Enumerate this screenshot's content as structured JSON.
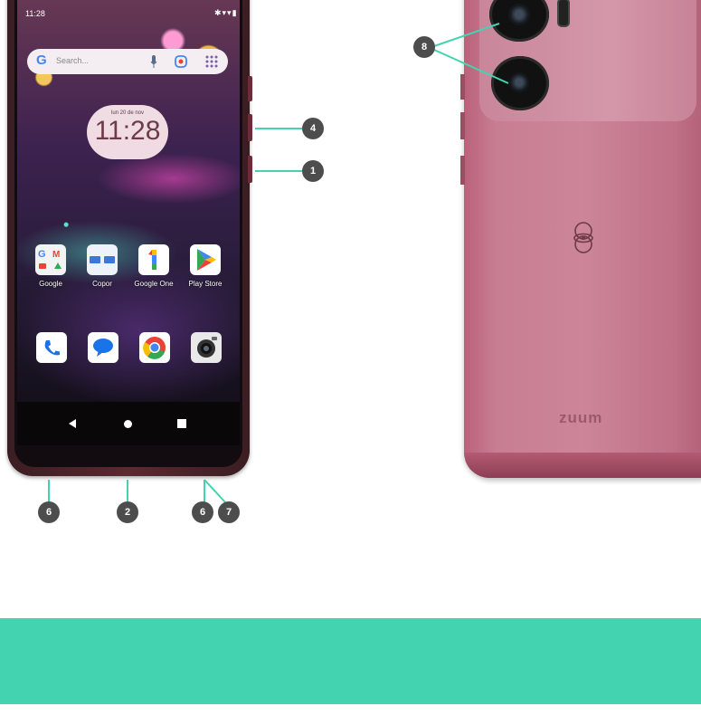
{
  "status_bar": {
    "time": "11:28",
    "icons": "✱▾▾▮"
  },
  "search": {
    "placeholder": "Search..."
  },
  "clock": {
    "date": "lun 20 de nov",
    "time": "11:28"
  },
  "apps_row1": [
    {
      "label": "Google"
    },
    {
      "label": "Copor"
    },
    {
      "label": "Google One"
    },
    {
      "label": "Play Store"
    }
  ],
  "dock": [
    "phone-icon",
    "messages-icon",
    "chrome-icon",
    "camera-icon"
  ],
  "callouts": {
    "c1": "1",
    "c2": "2",
    "c4": "4",
    "c6a": "6",
    "c6b": "6",
    "c7": "7",
    "c8": "8"
  },
  "back": {
    "brand": "zuum"
  },
  "colors": {
    "accent": "#43d3b0",
    "badge": "#4d4d4d",
    "phone_back": "#c87d92"
  }
}
